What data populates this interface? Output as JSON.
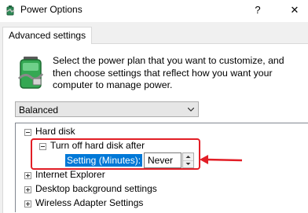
{
  "window": {
    "title": "Power Options",
    "help_label": "?",
    "close_label": "✕",
    "app_icon": "power-options-icon"
  },
  "tabs": [
    {
      "label": "Advanced settings",
      "active": true
    }
  ],
  "description": "Select the power plan that you want to customize, and then choose settings that reflect how you want your computer to manage power.",
  "plan_dropdown": {
    "selected": "Balanced"
  },
  "tree": {
    "items": [
      {
        "label": "Hard disk",
        "state": "expanded"
      },
      {
        "label": "Turn off hard disk after",
        "state": "expanded"
      },
      {
        "label": "Internet Explorer",
        "state": "collapsed"
      },
      {
        "label": "Desktop background settings",
        "state": "collapsed"
      },
      {
        "label": "Wireless Adapter Settings",
        "state": "collapsed"
      }
    ],
    "setting": {
      "label": "Setting (Minutes):",
      "value": "Never"
    }
  },
  "annotation": {
    "color": "#e21e26"
  }
}
